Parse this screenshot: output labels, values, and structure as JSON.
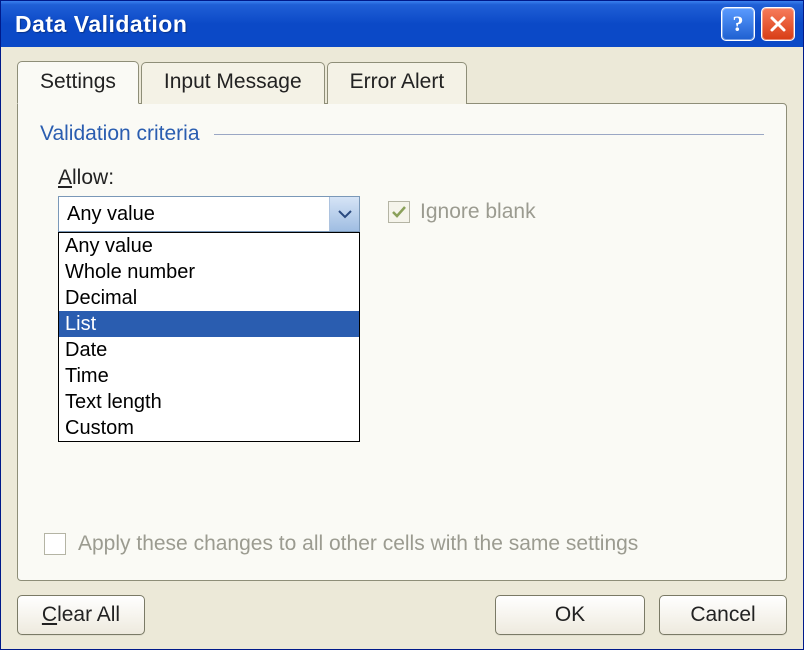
{
  "window": {
    "title": "Data Validation"
  },
  "tabs": {
    "settings": "Settings",
    "input_message": "Input Message",
    "error_alert": "Error Alert",
    "active": "settings"
  },
  "section": {
    "heading": "Validation criteria"
  },
  "allow": {
    "label_prefix": "A",
    "label_rest": "llow:",
    "selected": "Any value",
    "options": [
      "Any value",
      "Whole number",
      "Decimal",
      "List",
      "Date",
      "Time",
      "Text length",
      "Custom"
    ],
    "highlighted_index": 3
  },
  "ignore_blank": {
    "label": "Ignore blank",
    "checked": true,
    "enabled": false
  },
  "apply_all": {
    "label": "Apply these changes to all other cells with the same settings",
    "checked": false,
    "enabled": false
  },
  "buttons": {
    "clear_all_prefix": "C",
    "clear_all_rest": "lear All",
    "ok": "OK",
    "cancel": "Cancel"
  }
}
